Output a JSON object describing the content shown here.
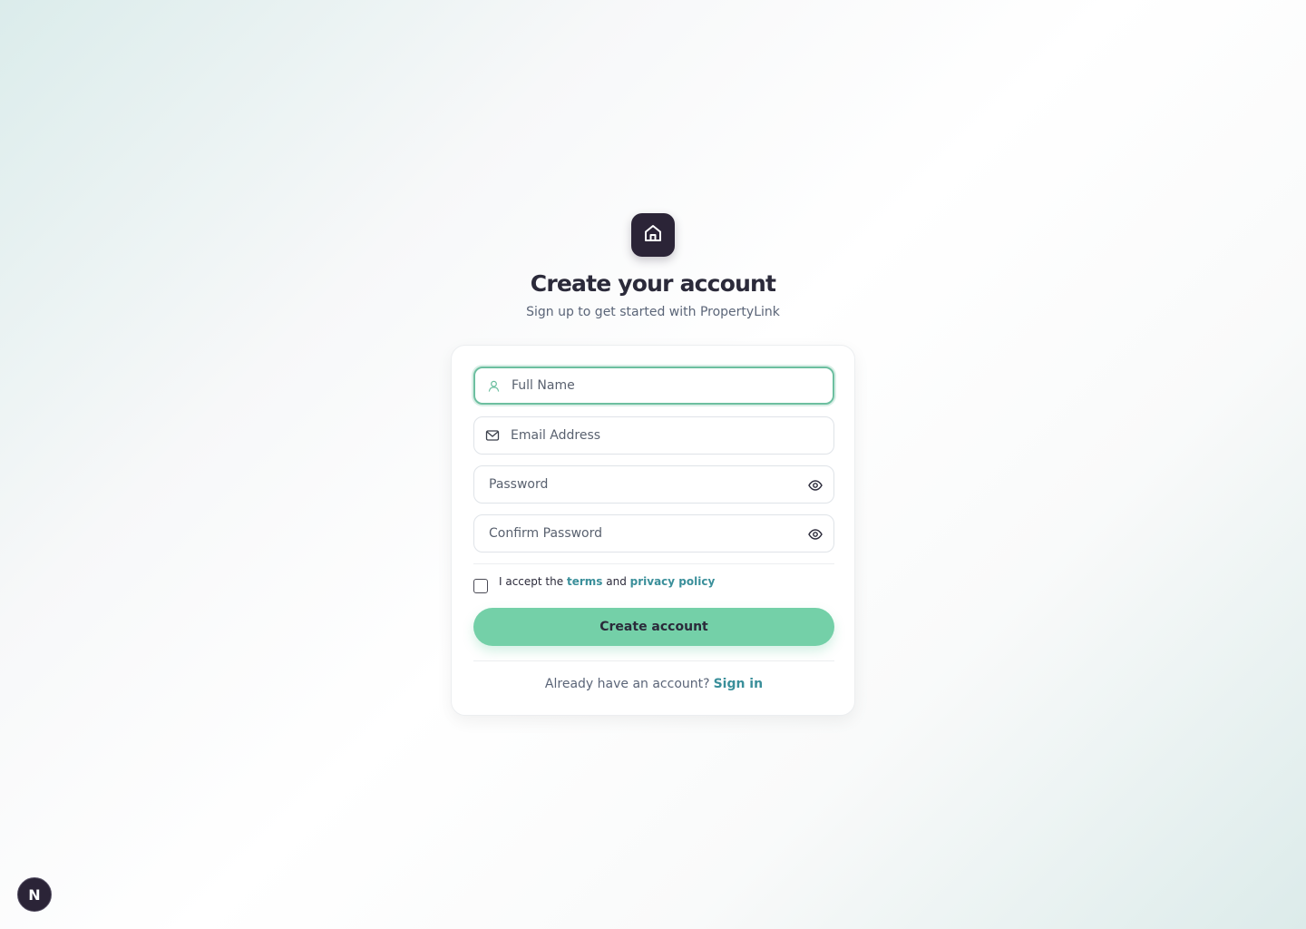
{
  "brand": {
    "logo_icon": "home-icon"
  },
  "header": {
    "title": "Create your account",
    "subtitle": "Sign up to get started with PropertyLink"
  },
  "form": {
    "full_name": {
      "placeholder": "Full Name",
      "value": "",
      "icon": "user-icon"
    },
    "email": {
      "placeholder": "Email Address",
      "value": "",
      "icon": "mail-icon"
    },
    "password": {
      "placeholder": "Password",
      "value": "",
      "toggle_icon": "eye-icon"
    },
    "confirm_password": {
      "placeholder": "Confirm Password",
      "value": "",
      "toggle_icon": "eye-icon"
    },
    "terms": {
      "checked": false,
      "prefix": "I accept the",
      "terms_link": "terms",
      "joiner": "and",
      "privacy_link": "privacy policy"
    },
    "submit_label": "Create account"
  },
  "footer": {
    "question": "Already have an account?",
    "signin_link": "Sign in"
  },
  "dev_badge": {
    "label": "N"
  },
  "colors": {
    "accent": "#74d0a8",
    "focus_border": "#6dbfa0",
    "link": "#3a8f9a",
    "dark": "#2b2437"
  }
}
